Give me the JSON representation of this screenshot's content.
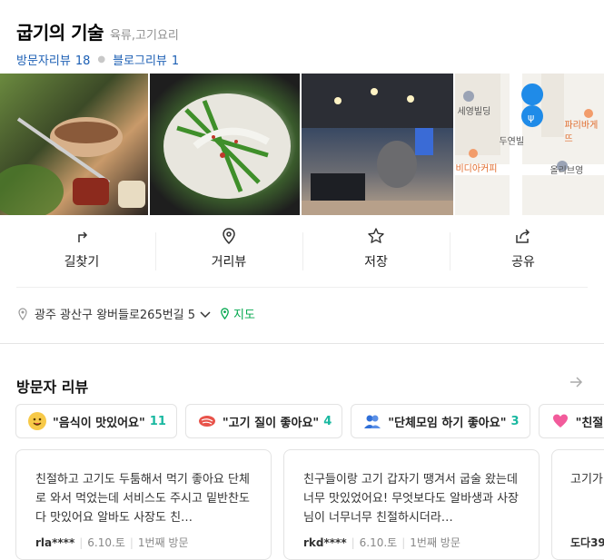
{
  "place": {
    "title": "굽기의 기술",
    "category": "육류,고기요리",
    "visitor_review_label": "방문자리뷰",
    "visitor_review_count": "18",
    "blog_review_label": "블로그리뷰",
    "blog_review_count": "1"
  },
  "map": {
    "labels": [
      "세영빌딩",
      "두연빌",
      "파리바게뜨",
      "비디아커피",
      "올리브영"
    ]
  },
  "actions": [
    {
      "label": "길찾기",
      "icon": "directions-icon"
    },
    {
      "label": "거리뷰",
      "icon": "street-view-icon"
    },
    {
      "label": "저장",
      "icon": "star-icon"
    },
    {
      "label": "공유",
      "icon": "share-icon"
    }
  ],
  "address": {
    "text": "광주 광산구 왕버들로265번길 5",
    "map_link": "지도"
  },
  "visitor_reviews": {
    "title": "방문자 리뷰",
    "chips": [
      {
        "emoji": "yummy-face-icon",
        "text": "\"음식이 맛있어요\"",
        "count": "11"
      },
      {
        "emoji": "meat-icon",
        "text": "\"고기 질이 좋아요\"",
        "count": "4"
      },
      {
        "emoji": "group-icon",
        "text": "\"단체모임 하기 좋아요\"",
        "count": "3"
      },
      {
        "emoji": "heart-icon",
        "text": "\"친절",
        "count": ""
      }
    ],
    "cards": [
      {
        "text": "친절하고 고기도 두툼해서 먹기 좋아요 단체로 와서 먹었는데 서비스도 주시고 밑반찬도 다 맛있어요 알바도 사장도 친…",
        "user": "rla****",
        "date": "6.10.토",
        "visit": "1번째 방문"
      },
      {
        "text": "친구들이랑 고기 갑자기 땡겨서 굽술 왔는데 너무 맛있었어요! 무엇보다도 알바생과 사장님이 너무너무 친절하시더라…",
        "user": "rkd****",
        "date": "6.10.토",
        "visit": "1번째 방문"
      },
      {
        "text": "고기가",
        "user": "도다39",
        "date": "",
        "visit": ""
      }
    ]
  },
  "colors": {
    "link_blue": "#1c5fb4",
    "map_green": "#03a84e",
    "count_teal": "#19b8a0"
  }
}
